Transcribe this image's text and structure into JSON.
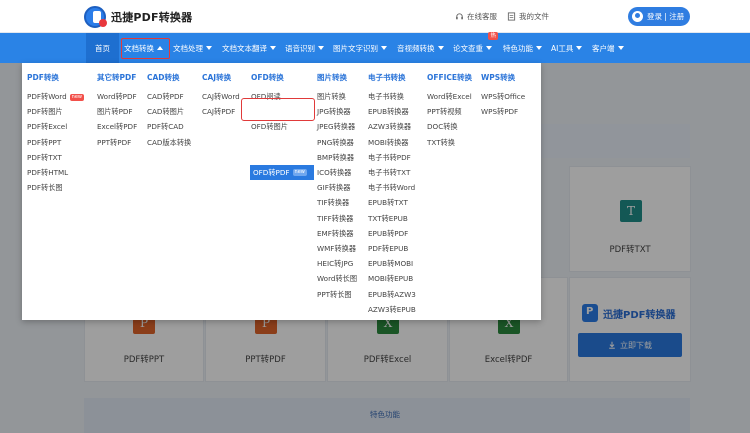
{
  "brand": {
    "name": "迅捷PDF转换器"
  },
  "header": {
    "service_label": "在线客服",
    "files_label": "我的文件",
    "login_label": "登录 | 注册"
  },
  "nav": {
    "items": [
      {
        "label": "首页"
      },
      {
        "label": "文档转换"
      },
      {
        "label": "文档处理"
      },
      {
        "label": "文档文本翻译"
      },
      {
        "label": "语音识别"
      },
      {
        "label": "图片文字识别"
      },
      {
        "label": "音视频转换"
      },
      {
        "label": "论文查重"
      },
      {
        "label": "特色功能"
      },
      {
        "label": "AI工具"
      },
      {
        "label": "客户端"
      }
    ],
    "hot_badge": "热"
  },
  "dropdown": {
    "new_badge": "new",
    "columns": [
      {
        "head": "PDF转换",
        "items": [
          "PDF转Word",
          "PDF转图片",
          "PDF转Excel",
          "PDF转PPT",
          "PDF转TXT",
          "PDF转HTML",
          "PDF转长图"
        ]
      },
      {
        "head": "其它转PDF",
        "items": [
          "Word转PDF",
          "图片转PDF",
          "Excel转PDF",
          "PPT转PDF"
        ]
      },
      {
        "head": "CAD转换",
        "items": [
          "CAD转PDF",
          "CAD转图片",
          "PDF转CAD",
          "CAD版本转换"
        ]
      },
      {
        "head": "CAJ转换",
        "items": [
          "CAJ转Word",
          "CAJ转PDF"
        ]
      },
      {
        "head": "OFD转换",
        "items": [
          "OFD阅读",
          "OFD转PDF",
          "OFD转图片"
        ]
      },
      {
        "head": "图片转换",
        "items": [
          "图片转换",
          "JPG转换器",
          "JPEG转换器",
          "PNG转换器",
          "BMP转换器",
          "ICO转换器",
          "GIF转换器",
          "TIF转换器",
          "TIFF转换器",
          "EMF转换器",
          "WMF转换器",
          "HEIC转JPG",
          "Word转长图",
          "PPT转长图"
        ]
      },
      {
        "head": "电子书转换",
        "items": [
          "电子书转换",
          "EPUB转换器",
          "AZW3转换器",
          "MOBI转换器",
          "电子书转PDF",
          "电子书转TXT",
          "电子书转Word",
          "EPUB转TXT",
          "TXT转EPUB",
          "EPUB转PDF",
          "PDF转EPUB",
          "EPUB转MOBI",
          "MOBI转EPUB",
          "EPUB转AZW3",
          "AZW3转EPUB"
        ]
      },
      {
        "head": "OFFICE转换",
        "items": [
          "Word转Excel",
          "PPT转视频",
          "DOC转换",
          "TXT转换"
        ]
      },
      {
        "head": "WPS转换",
        "items": [
          "WPS转Office",
          "WPS转PDF"
        ]
      }
    ]
  },
  "tiles": [
    {
      "label": "PDF转TXT",
      "icon": "T"
    },
    {
      "label": "PDF转PPT",
      "icon": "P"
    },
    {
      "label": "PPT转PDF",
      "icon": "P"
    },
    {
      "label": "PDF转Excel",
      "icon": "X"
    },
    {
      "label": "Excel转PDF",
      "icon": "X"
    }
  ],
  "promo": {
    "brand": "迅捷PDF转换器",
    "download_label": "立即下载"
  },
  "feature_strip": {
    "label": "特色功能"
  }
}
